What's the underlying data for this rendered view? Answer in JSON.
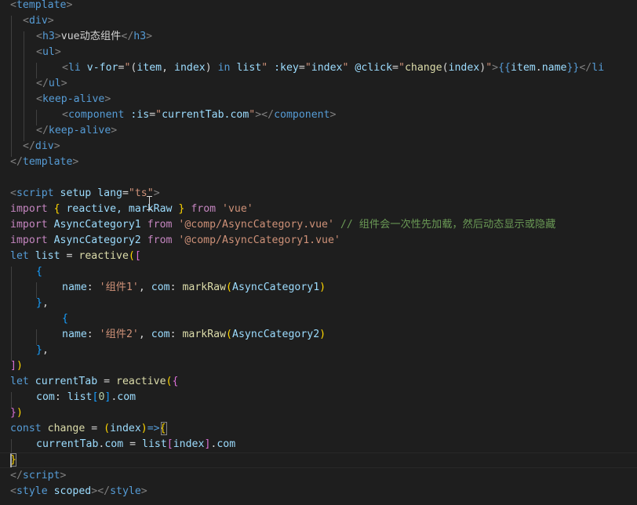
{
  "editor": {
    "language_hint": "vue",
    "colors": {
      "background": "#1e1e1e",
      "tag": "#569cd6",
      "attribute": "#9cdcfe",
      "string": "#ce9178",
      "keyword": "#c586c0",
      "function": "#dcdcaa",
      "comment": "#6a9955",
      "number": "#b5cea8"
    }
  },
  "tokens": {
    "l1_open": "<",
    "l1_tag": "template",
    "l1_close": ">",
    "l2_open": "<",
    "l2_tag": "div",
    "l2_close": ">",
    "l3_open": "<",
    "l3_tag": "h3",
    "l3_close": ">",
    "l3_text": "vue动态组件",
    "l3_end_open": "</",
    "l3_end_tag": "h3",
    "l3_end_close": ">",
    "l4_open": "<",
    "l4_tag": "ul",
    "l4_close": ">",
    "l5_open": "<",
    "l5_tag": "li",
    "l5_attr1": "v-for",
    "l5_eq1": "=",
    "l5_q1": "\"",
    "l5_b1o": "(",
    "l5_item": "item",
    "l5_comma": ", ",
    "l5_index": "index",
    "l5_b1c": ")",
    "l5_in": " in ",
    "l5_list": "list",
    "l5_q2": "\"",
    "l5_attr2": ":key",
    "l5_eq2": "=",
    "l5_q3": "\"",
    "l5_index2": "index",
    "l5_q4": "\"",
    "l5_attr3": "@click",
    "l5_eq3": "=",
    "l5_q5": "\"",
    "l5_change": "change",
    "l5_b2o": "(",
    "l5_index3": "index",
    "l5_b2c": ")",
    "l5_q6": "\"",
    "l5_close": ">",
    "l5_mo": "{{",
    "l5_item2": "item",
    "l5_dot": ".",
    "l5_name": "name",
    "l5_mc": "}}",
    "l5_end_open": "</",
    "l5_end_tag": "li",
    "l6_open": "</",
    "l6_tag": "ul",
    "l6_close": ">",
    "l7_open": "<",
    "l7_tag": "keep-alive",
    "l7_close": ">",
    "l8_open": "<",
    "l8_tag": "component",
    "l8_attr": ":is",
    "l8_eq": "=",
    "l8_q1": "\"",
    "l8_val": "currentTab.com",
    "l8_q2": "\"",
    "l8_close": ">",
    "l8_end_open": "</",
    "l8_end_tag": "component",
    "l8_end_close": ">",
    "l9_open": "</",
    "l9_tag": "keep-alive",
    "l9_close": ">",
    "l10_open": "</",
    "l10_tag": "div",
    "l10_close": ">",
    "l11_open": "</",
    "l11_tag": "template",
    "l11_close": ">",
    "l13_open": "<",
    "l13_tag": "script",
    "l13_attr1": "setup",
    "l13_attr2": "lang",
    "l13_eq": "=",
    "l13_val": "\"ts\"",
    "l13_close": ">",
    "l14_import": "import",
    "l14_bo": "{",
    "l14_names": " reactive, markRaw ",
    "l14_bc": "}",
    "l14_from": "from",
    "l14_src": "'vue'",
    "l15_import": "import",
    "l15_name": "AsyncCategory1",
    "l15_from": "from",
    "l15_src": "'@comp/AsyncCategory.vue'",
    "l15_comment": "// 组件会一次性先加载，然后动态显示或隐藏",
    "l16_import": "import",
    "l16_name": "AsyncCategory2",
    "l16_from": "from",
    "l16_src": "'@comp/AsyncCategory1.vue'",
    "l17_let": "let",
    "l17_var": "list",
    "l17_eq": " = ",
    "l17_fn": "reactive",
    "l17_po": "(",
    "l17_ao": "[",
    "l18_bo": "{",
    "l19_key": "name",
    "l19_colon": ": ",
    "l19_val": "'组件1'",
    "l19_comma": ", ",
    "l19_key2": "com",
    "l19_colon2": ": ",
    "l19_fn": "markRaw",
    "l19_po": "(",
    "l19_arg": "AsyncCategory1",
    "l19_pc": ")",
    "l20_bc": "}",
    "l20_comma": ",",
    "l21_bo": "{",
    "l22_key": "name",
    "l22_colon": ": ",
    "l22_val": "'组件2'",
    "l22_comma": ", ",
    "l22_key2": "com",
    "l22_colon2": ": ",
    "l22_fn": "markRaw",
    "l22_po": "(",
    "l22_arg": "AsyncCategory2",
    "l22_pc": ")",
    "l23_bc": "}",
    "l23_comma": ",",
    "l24_ac": "]",
    "l24_pc": ")",
    "l25_let": "let",
    "l25_var": "currentTab",
    "l25_eq": " = ",
    "l25_fn": "reactive",
    "l25_po": "(",
    "l25_bo": "{",
    "l26_key": "com",
    "l26_colon": ": ",
    "l26_list": "list",
    "l26_ao": "[",
    "l26_num": "0",
    "l26_ac": "]",
    "l26_dot": ".",
    "l26_com": "com",
    "l27_bc": "}",
    "l27_pc": ")",
    "l28_const": "const",
    "l28_name": "change",
    "l28_eq": " = ",
    "l28_po": "(",
    "l28_param": "index",
    "l28_pc": ")",
    "l28_arrow": "=>",
    "l28_bo": "{",
    "l29_obj": "currentTab",
    "l29_dot": ".",
    "l29_prop": "com",
    "l29_eq": " = ",
    "l29_list": "list",
    "l29_ao": "[",
    "l29_idx": "index",
    "l29_ac": "]",
    "l29_dot2": ".",
    "l29_prop2": "com",
    "l30_bc": "}",
    "l31_open": "</",
    "l31_tag": "script",
    "l31_close": ">",
    "l32_open": "<",
    "l32_tag": "style",
    "l32_attr": "scoped",
    "l32_close": ">",
    "l32_end_open": "</",
    "l32_end_tag": "style",
    "l32_end_close": ">"
  }
}
